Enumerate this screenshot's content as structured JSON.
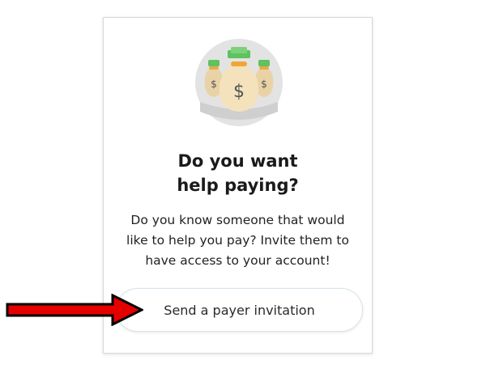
{
  "card": {
    "illustration_icon": "money-bags-icon",
    "title_line1": "Do you want",
    "title_line2": "help paying?",
    "description_lines": [
      "Do you know someone that would",
      "like to help you pay? Invite them to",
      "have access to your account!"
    ],
    "cta_label": "Send a payer invitation"
  },
  "annotation": {
    "arrow_icon": "red-arrow-icon",
    "arrow_color": "#e50000"
  },
  "colors": {
    "illustration_circle": "#e3e3e3",
    "bag": "#f4e2bd",
    "money": "#5ec25e",
    "tie": "#f0a634"
  }
}
